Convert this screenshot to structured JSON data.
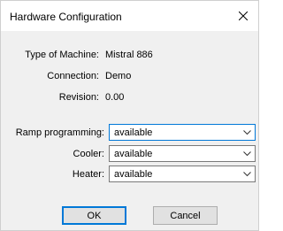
{
  "dialog": {
    "title": "Hardware Configuration"
  },
  "info": {
    "type_label": "Type of Machine:",
    "type_value": "Mistral 886",
    "connection_label": "Connection:",
    "connection_value": "Demo",
    "revision_label": "Revision:",
    "revision_value": "0.00"
  },
  "settings": {
    "ramp_label": "Ramp programming:",
    "ramp_value": "available",
    "cooler_label": "Cooler:",
    "cooler_value": "available",
    "heater_label": "Heater:",
    "heater_value": "available"
  },
  "buttons": {
    "ok": "OK",
    "cancel": "Cancel"
  },
  "icons": {
    "close": "close-icon",
    "dropdown": "chevron-down-icon"
  },
  "colors": {
    "accent": "#0078d7",
    "dialog_bg": "#f0f0f0"
  }
}
